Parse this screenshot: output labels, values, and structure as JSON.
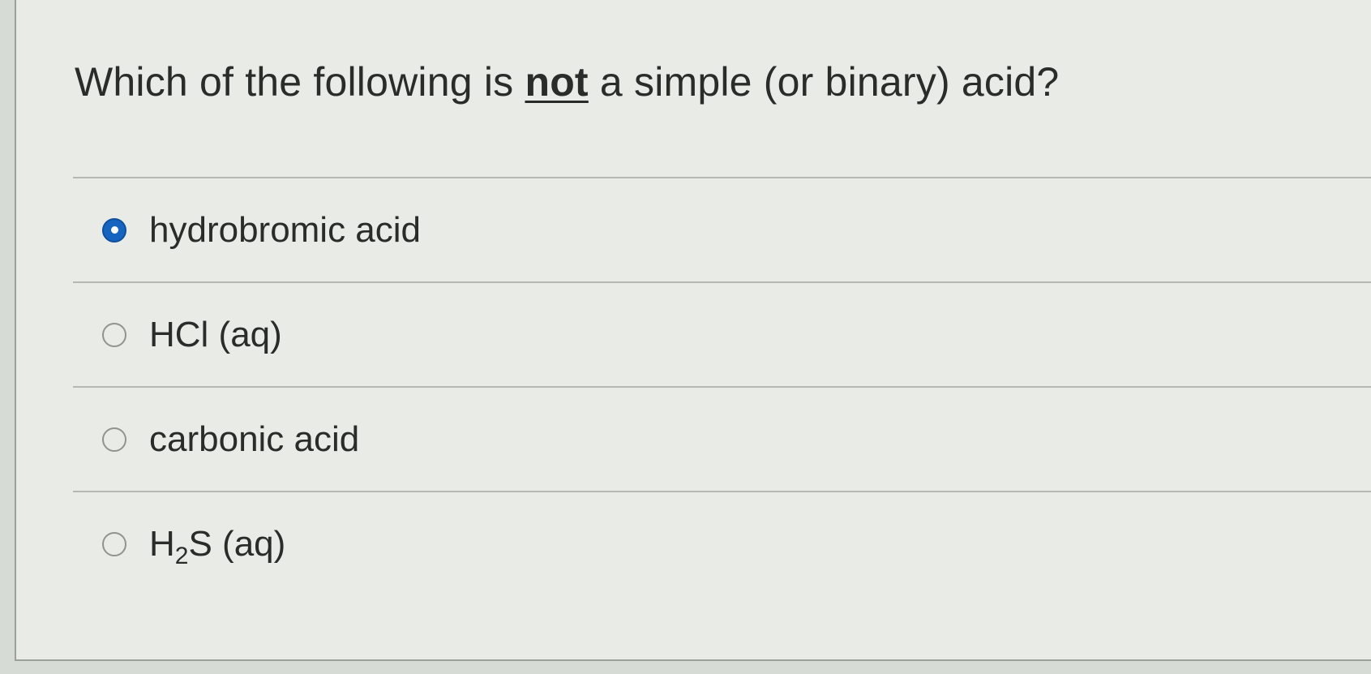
{
  "question": {
    "prefix": "Which of the following is ",
    "emphasis": "not",
    "suffix": " a simple (or binary) acid?"
  },
  "options": [
    {
      "label": "hydrobromic acid",
      "selected": true
    },
    {
      "label": "HCl (aq)",
      "selected": false
    },
    {
      "label": "carbonic acid",
      "selected": false
    },
    {
      "label_parts": {
        "pre": "H",
        "sub": "2",
        "post": "S (aq)"
      },
      "selected": false
    }
  ],
  "colors": {
    "selected_radio": "#1565c0",
    "text": "#2a2c2a",
    "divider": "#b3b8b2",
    "background": "#e9ece6"
  }
}
